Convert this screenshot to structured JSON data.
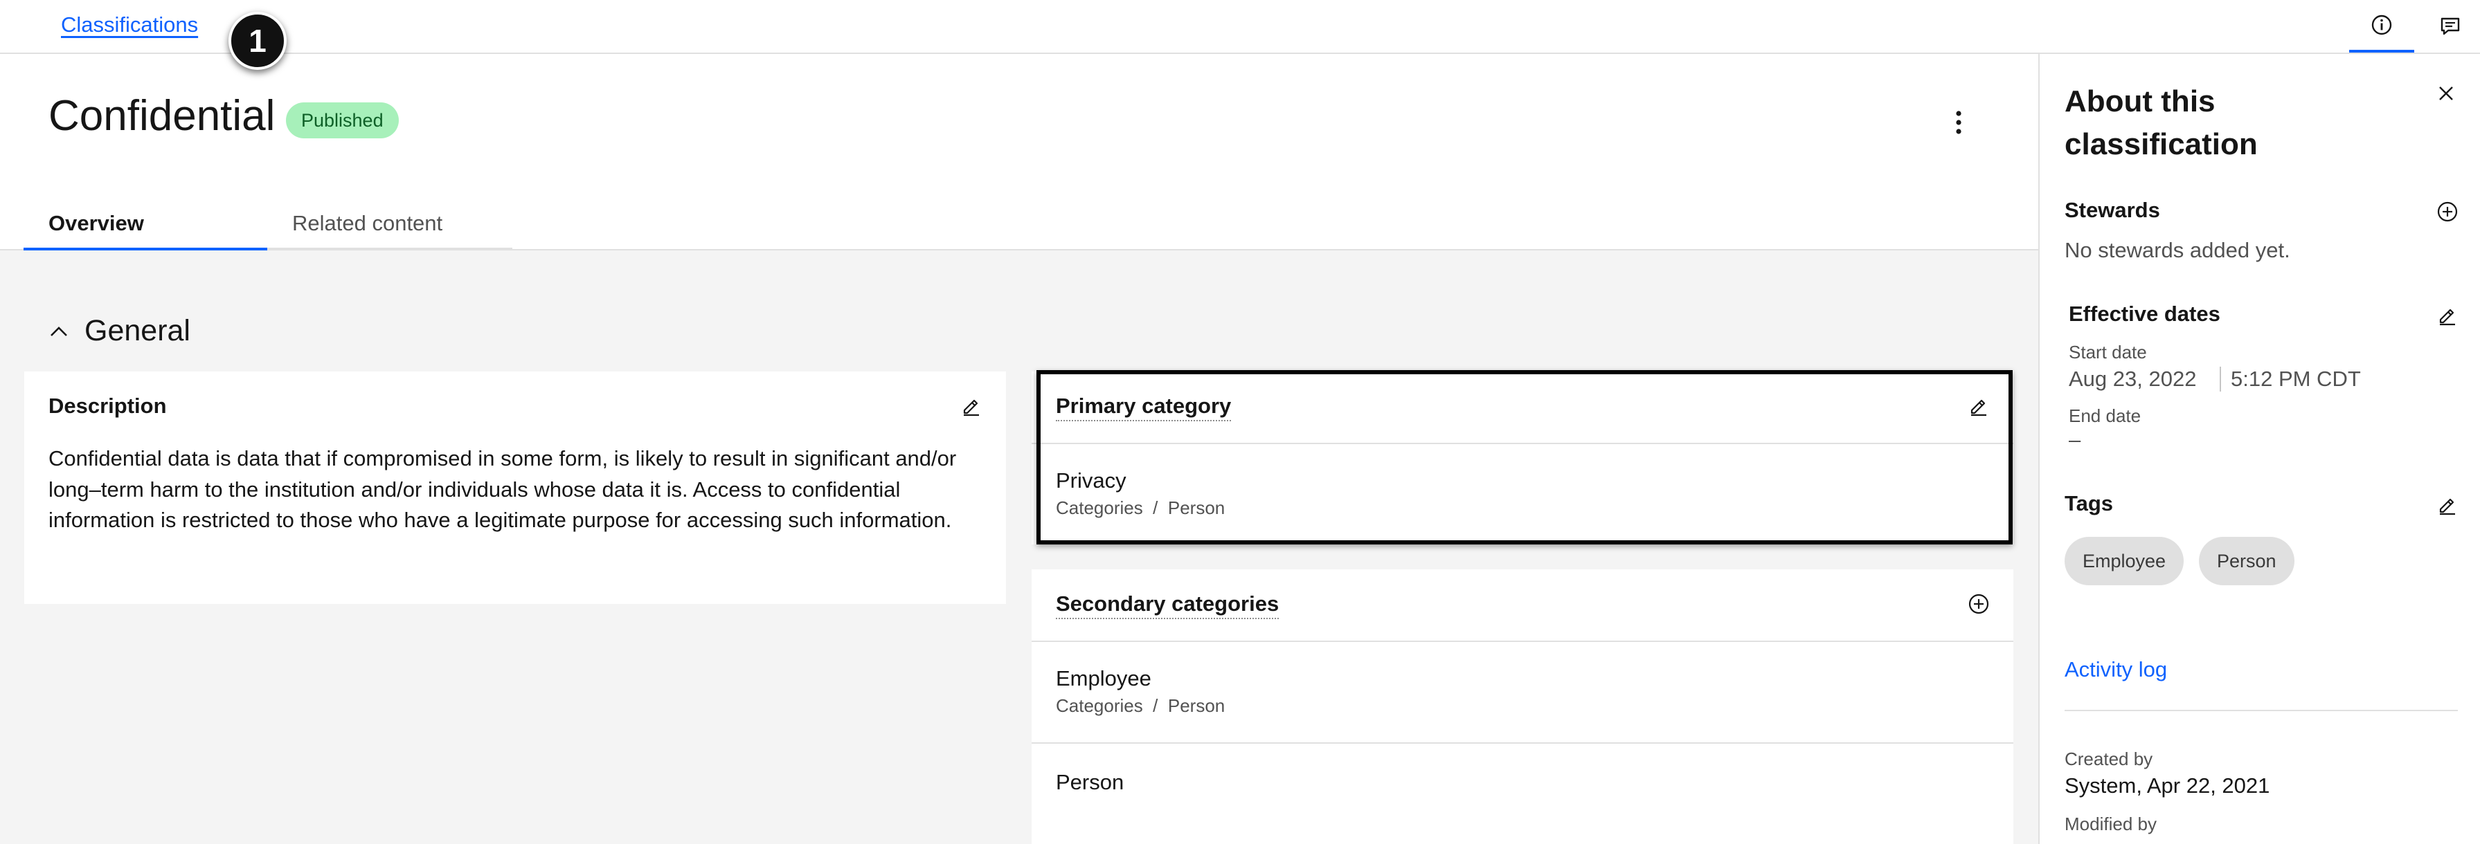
{
  "breadcrumb": {
    "link": "Classifications"
  },
  "step_badge": "1",
  "topbar_icons": [
    "info-icon",
    "comment-icon"
  ],
  "page": {
    "title": "Confidential",
    "status": "Published",
    "tabs": [
      {
        "label": "Overview",
        "active": true
      },
      {
        "label": "Related content",
        "active": false
      }
    ]
  },
  "general": {
    "section_title": "General",
    "description": {
      "title": "Description",
      "text": "Confidential data is data that if compromised in some form, is likely to result in significant and/or long–term harm to the institution and/or individuals whose data it is. Access to confidential information is restricted to those who have a legitimate purpose for accessing such information."
    },
    "primary_category": {
      "title": "Primary category",
      "item": {
        "name": "Privacy",
        "path": "Categories  /  Person"
      }
    },
    "secondary_categories": {
      "title": "Secondary categories",
      "items": [
        {
          "name": "Employee",
          "path": "Categories  /  Person"
        },
        {
          "name": "Person",
          "path": ""
        }
      ]
    }
  },
  "side_panel": {
    "title": "About this classification",
    "stewards": {
      "heading": "Stewards",
      "empty_text": "No stewards added yet."
    },
    "effective_dates": {
      "heading": "Effective dates",
      "start_label": "Start date",
      "start_date": "Aug 23, 2022",
      "start_time": "5:12 PM CDT",
      "end_label": "End date",
      "end_value": "–"
    },
    "tags": {
      "heading": "Tags",
      "items": [
        "Employee",
        "Person"
      ]
    },
    "activity_log": "Activity log",
    "created_by": {
      "label": "Created by",
      "value": "System, Apr 22, 2021"
    },
    "modified_by": {
      "label": "Modified by"
    }
  },
  "colors": {
    "accent": "#0f62fe",
    "published_bg": "#a7f0ba",
    "published_text": "#0e6027",
    "tag_bg": "#e0e0e0"
  }
}
